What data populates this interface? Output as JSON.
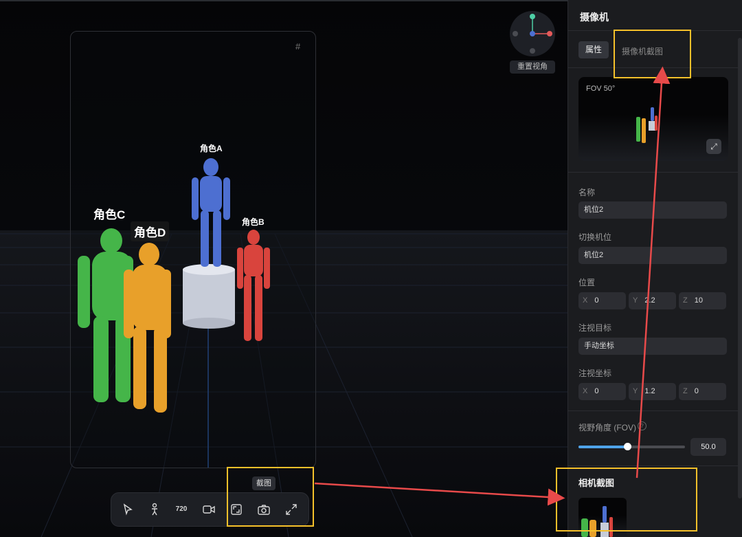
{
  "viewport": {
    "reset_view_label": "重置视角",
    "characters": {
      "a": "角色A",
      "b": "角色B",
      "c": "角色C",
      "d": "角色D"
    },
    "tooltip": "截图",
    "toolbar_icons": [
      "cursor-icon",
      "person-icon",
      "rotate-720-icon",
      "video-icon",
      "frame-icon",
      "camera-icon",
      "expand-icon"
    ],
    "colors": {
      "character_a": "#4d6fd1",
      "character_b": "#d9443d",
      "character_c": "#45b549",
      "character_d": "#e8a02a",
      "highlight": "#f6c12a",
      "annotation_arrow": "#e84a4a"
    }
  },
  "panel": {
    "title": "摄像机",
    "tabs": {
      "properties": "属性",
      "camera_shot": "摄像机截图"
    },
    "preview": {
      "fov_label": "FOV 50°"
    },
    "name": {
      "label": "名称",
      "value": "机位2"
    },
    "switch_camera": {
      "label": "切换机位",
      "value": "机位2"
    },
    "position": {
      "label": "位置",
      "x": "0",
      "y": "2.2",
      "z": "10"
    },
    "look_target": {
      "label": "注视目标",
      "value": "手动坐标"
    },
    "look_coords": {
      "label": "注视坐标",
      "x": "0",
      "y": "1.2",
      "z": "0"
    },
    "fov": {
      "label": "视野角度 (FOV)",
      "value": "50.0",
      "help": "?",
      "slider_fraction": 0.46
    },
    "camera_shots": {
      "title": "相机截图"
    },
    "axis": {
      "x": "X",
      "y": "Y",
      "z": "Z"
    },
    "accent": "#4fa3e8"
  }
}
